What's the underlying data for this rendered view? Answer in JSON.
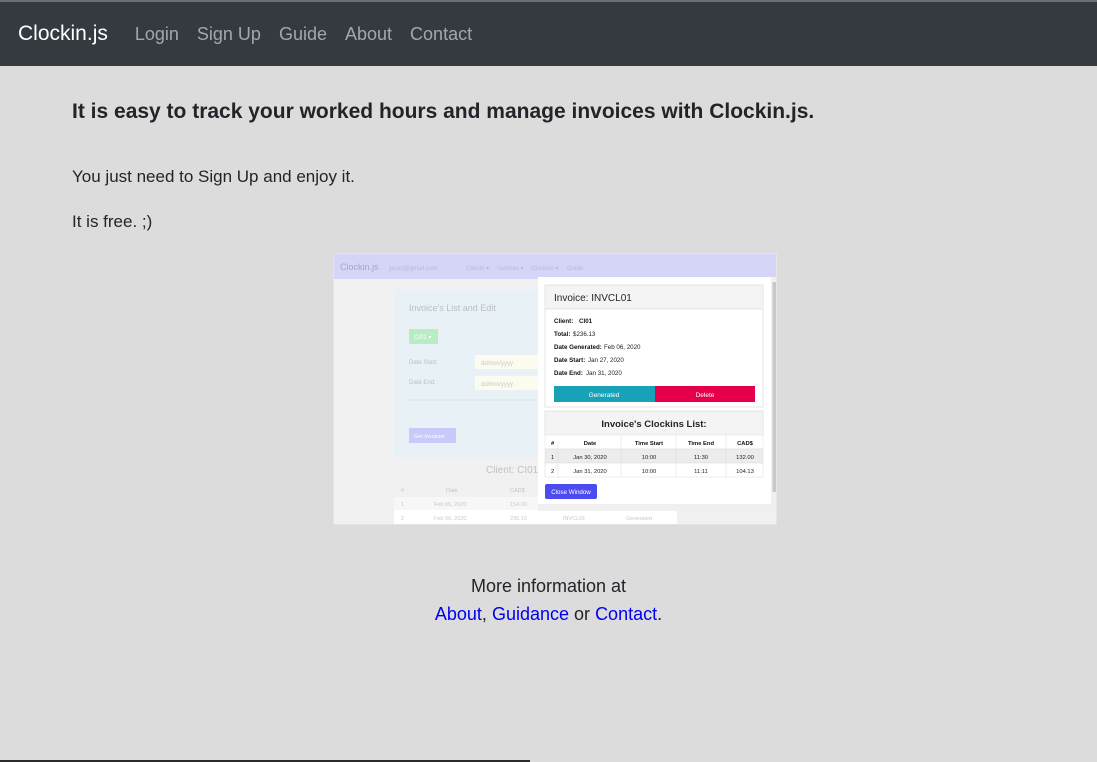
{
  "navbar": {
    "brand": "Clockin.js",
    "links": [
      "Login",
      "Sign Up",
      "Guide",
      "About",
      "Contact"
    ]
  },
  "main": {
    "headline": "It is easy to track your worked hours and manage invoices with Clockin.js.",
    "line1": "You just need to Sign Up and enjoy it.",
    "line2": "It is free. ;)",
    "more_text": "More information at",
    "more_link1": "About",
    "more_comma": ",",
    "more_link2": "Guidance",
    "more_or": "or",
    "more_link3": "Contact",
    "more_period": "."
  },
  "screenshot": {
    "bg_nav_brand": "Clockin.js",
    "bg_nav_items": [
      "yours@gmail.com",
      "Clients ▾",
      "Invoices ▾",
      "Clockins ▾",
      "Guide"
    ],
    "bg_panel_title": "Invoice's List and Edit",
    "bg_client_btn": "CI01 ▾",
    "bg_date_start_label": "Date Start:",
    "bg_date_end_label": "Date End:",
    "bg_date_placeholder": "dd/mm/yyyy",
    "bg_get_invoices": "Get Invoices",
    "bg_client_heading": "Client: CI01",
    "bg_table_head": [
      "#",
      "Date",
      "CAD$"
    ],
    "bg_rows": [
      [
        "1",
        "Feb 06, 2020",
        "154.00"
      ],
      [
        "2",
        "Feb 06, 2020",
        "236.13",
        "INVCL01",
        "Generated"
      ]
    ],
    "modal_title": "Invoice: INVCL01",
    "client_label": "Client:",
    "client_value": "CI01",
    "total_label": "Total:",
    "total_value": "$236.13",
    "gen_label": "Date Generated:",
    "gen_value": "Feb 06, 2020",
    "start_label": "Date Start:",
    "start_value": "Jan 27, 2020",
    "end_label": "Date End:",
    "end_value": "Jan 31, 2020",
    "btn_generated": "Generated",
    "btn_delete": "Delete",
    "list_title": "Invoice's Clockins List:",
    "list_head": [
      "#",
      "Date",
      "Time Start",
      "Time End",
      "CAD$"
    ],
    "list_rows": [
      [
        "1",
        "Jan 30, 2020",
        "10:00",
        "11:30",
        "132.00"
      ],
      [
        "2",
        "Jan 31, 2020",
        "10:00",
        "11:11",
        "104.13"
      ]
    ],
    "close_btn": "Close Window"
  },
  "colors": {
    "navbar_bg": "#343a40",
    "page_bg": "#dcdcdc",
    "link": "#0000ee",
    "generated_btn": "#17a2b8",
    "delete_btn": "#e6004c",
    "close_btn": "#4b4bf0"
  }
}
